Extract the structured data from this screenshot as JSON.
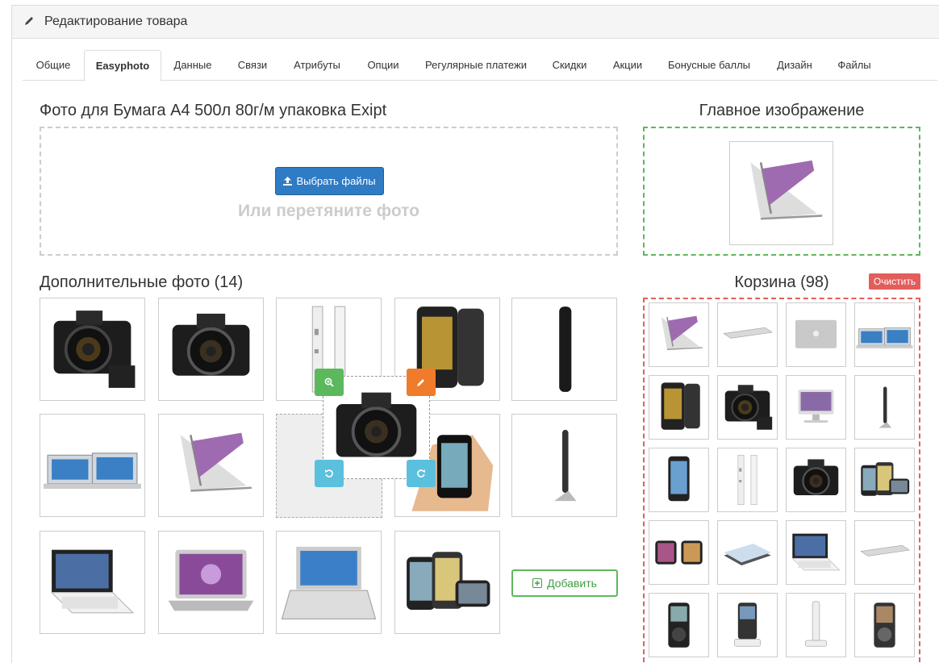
{
  "header": {
    "title": "Редактирование товара"
  },
  "tabs": [
    {
      "label": "Общие"
    },
    {
      "label": "Easyphoto",
      "active": true
    },
    {
      "label": "Данные"
    },
    {
      "label": "Связи"
    },
    {
      "label": "Атрибуты"
    },
    {
      "label": "Опции"
    },
    {
      "label": "Регулярные платежи"
    },
    {
      "label": "Скидки"
    },
    {
      "label": "Акции"
    },
    {
      "label": "Бонусные баллы"
    },
    {
      "label": "Дизайн"
    },
    {
      "label": "Файлы"
    }
  ],
  "upload": {
    "title": "Фото для Бумага А4 500л 80г/м упаковка Exipt",
    "button_label": "Выбрать файлы",
    "drop_hint": "Или перетяните фото"
  },
  "main_image": {
    "title": "Главное изображение",
    "photo": "laptop-thin"
  },
  "additional": {
    "title": "Дополнительные фото (14)",
    "add_label": "Добавить",
    "photos": [
      "camera-large",
      "camera-front",
      "ipod-side",
      "phone-touch",
      "phone-side",
      "laptops-pair",
      "laptop-thin",
      "placeholder",
      "phone-hand",
      "monitor-side",
      "laptop-black",
      "laptop-open",
      "laptop-silver",
      "phones-group"
    ],
    "dragging_photo": "camera-front"
  },
  "basket": {
    "title": "Корзина (98)",
    "clear_label": "Очистить",
    "photos": [
      "laptop-thin",
      "laptop-flat",
      "laptop-lid",
      "laptops-pair",
      "phone-touch",
      "camera-large",
      "monitor-front",
      "monitor-side",
      "phone-apple",
      "ipod-side",
      "camera-front",
      "phones-group",
      "phone-landscape",
      "phone-stack",
      "laptop-black",
      "laptop-flat",
      "ipod-black",
      "ipod-dock",
      "ipod-white",
      "ipod-gray"
    ]
  },
  "colors": {
    "primary": "#2f7bc4",
    "success": "#5cb85c",
    "warning": "#f07b2a",
    "info": "#5bc0de",
    "danger": "#e35d5b"
  }
}
